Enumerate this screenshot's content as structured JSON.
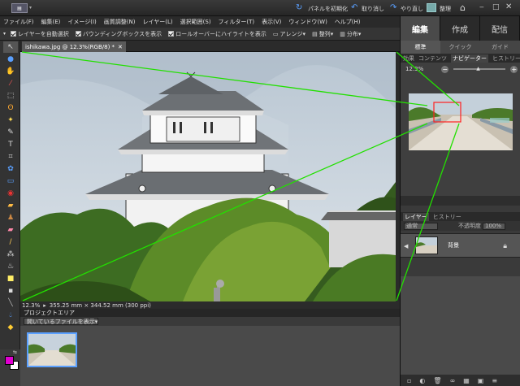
{
  "titlebar": {
    "reset_panels": "パネルを初期化",
    "undo": "取り消し",
    "redo": "やり直し",
    "organize": "整理"
  },
  "menu": [
    "ファイル(F)",
    "編集(E)",
    "イメージ(I)",
    "画質調整(N)",
    "レイヤー(L)",
    "選択範囲(S)",
    "フィルター(T)",
    "表示(V)",
    "ウィンドウ(W)",
    "ヘルプ(H)"
  ],
  "options": {
    "auto_select": "レイヤーを自動選択",
    "bounding_box": "バウンディングボックスを表示",
    "rollover": "ロールオーバーにハイライトを表示",
    "arrange": "アレンジ",
    "align": "整列",
    "distribute": "分布"
  },
  "document": {
    "tab_title": "ishikawa.jpg @ 12.3%(RGB/8) *",
    "zoom": "12.3%",
    "doc_size": "355.25 mm × 344.52 mm (300 ppi)"
  },
  "project_bin": {
    "header": "プロジェクトエリア",
    "dropdown": "開いているファイルを表示"
  },
  "mode_tabs": [
    "編集",
    "作成",
    "配信"
  ],
  "mode_active": 0,
  "sub_tabs": [
    "標準",
    "クイック",
    "ガイド"
  ],
  "sub_active": 0,
  "panel_tabs": [
    "効果",
    "コンテンツ",
    "ナビゲーター",
    "ヒストリー"
  ],
  "panel_active": 2,
  "navigator_zoom": "12.3%",
  "layer_tabs": [
    "レイヤー",
    "ヒストリー"
  ],
  "layer_controls": {
    "blend_mode": "通常",
    "opacity_label": "不透明度",
    "opacity": "100%"
  },
  "layer_name": "背景",
  "colors": {
    "foreground": "#e000d0",
    "background": "#ffffff",
    "indicator": "#22e000",
    "nav_rect": "#ff2020"
  }
}
